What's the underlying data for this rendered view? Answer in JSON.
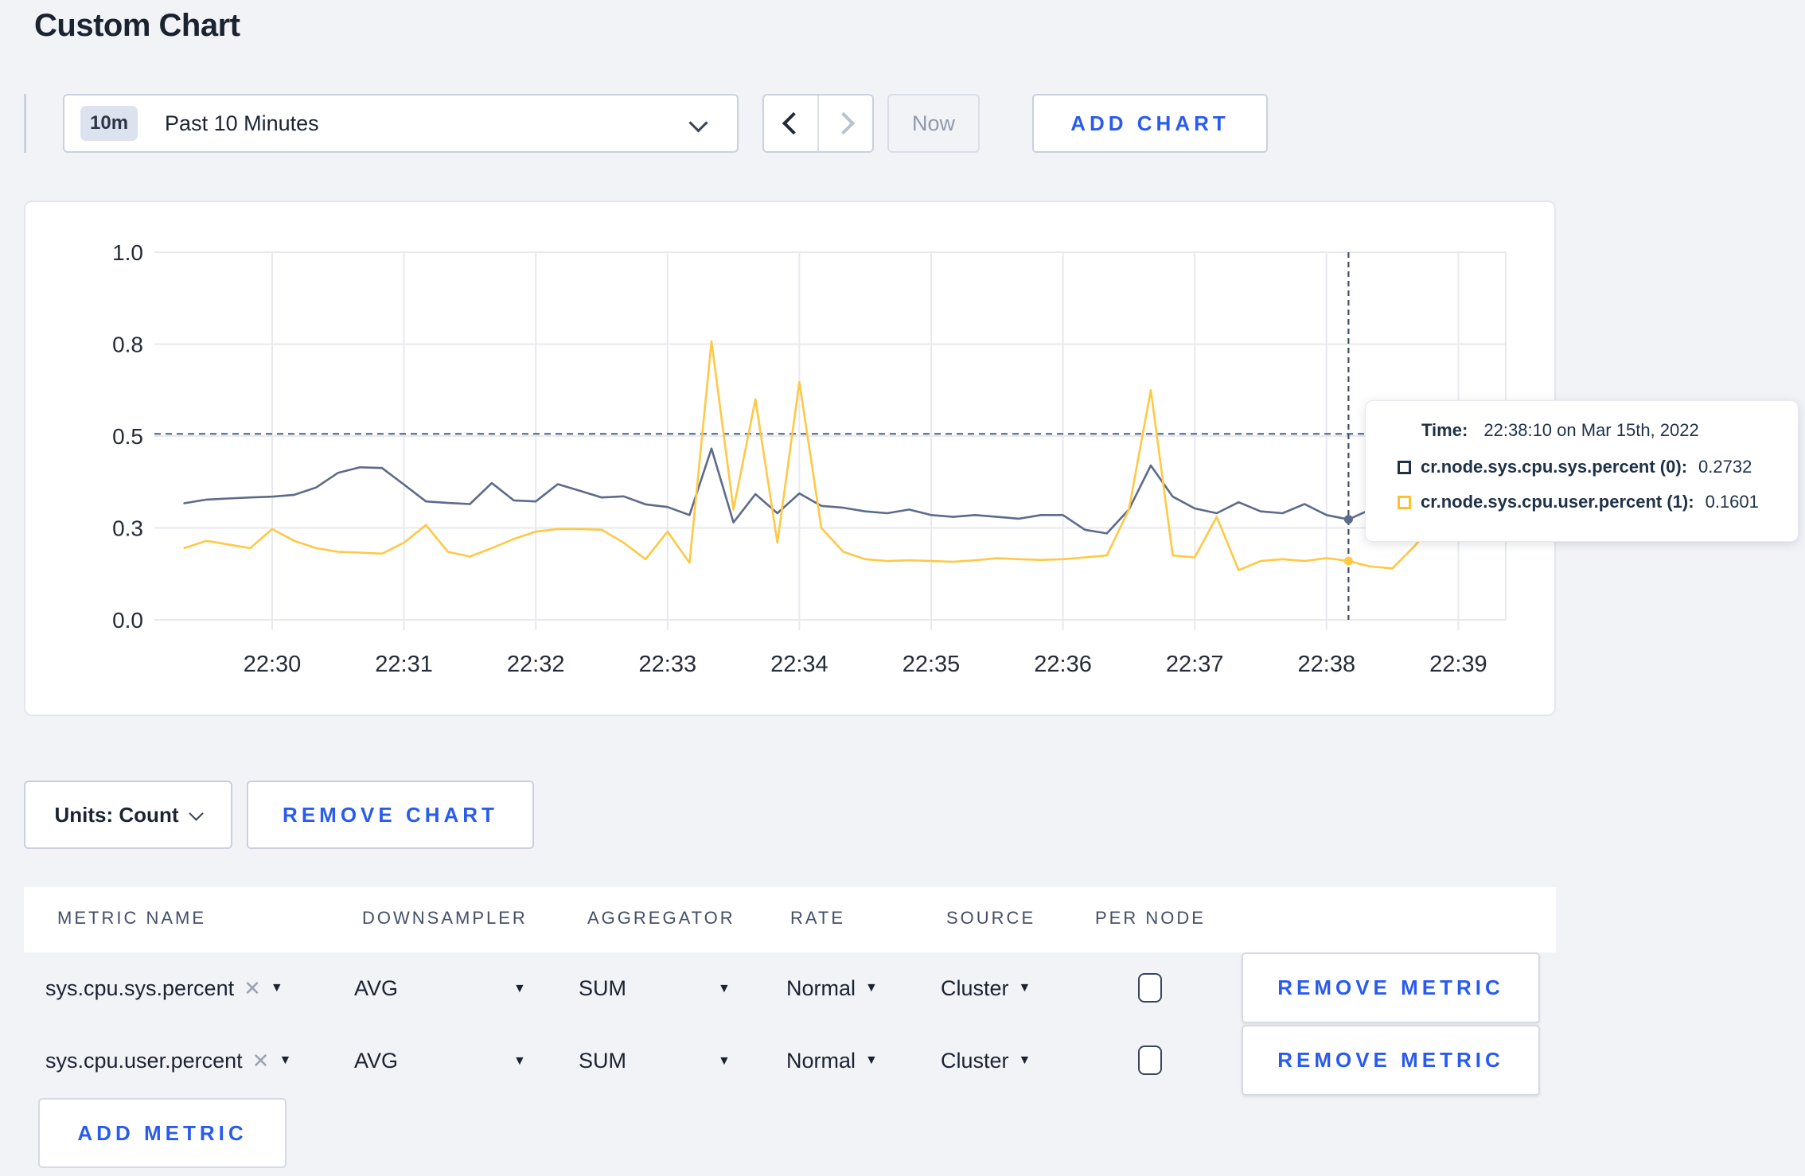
{
  "page": {
    "title": "Custom Chart"
  },
  "toolbar": {
    "time_selector": {
      "badge": "10m",
      "label": "Past 10 Minutes"
    },
    "now_button": "Now",
    "add_chart_button": "ADD CHART"
  },
  "chart_data": {
    "type": "line",
    "title": "",
    "xlabel": "",
    "ylabel": "",
    "start_time": "22:29:20",
    "interval_seconds": 10,
    "ylim": [
      0,
      1
    ],
    "grid": true,
    "legend_position": "tooltip-only",
    "y_ticks": [
      {
        "value": 0.0,
        "label": "0.0"
      },
      {
        "value": 0.25,
        "label": "0.3"
      },
      {
        "value": 0.5,
        "label": "0.5"
      },
      {
        "value": 0.75,
        "label": "0.8"
      },
      {
        "value": 1.0,
        "label": "1.0"
      }
    ],
    "x_ticks": [
      "22:30",
      "22:31",
      "22:32",
      "22:33",
      "22:34",
      "22:35",
      "22:36",
      "22:37",
      "22:38",
      "22:39"
    ],
    "series": [
      {
        "name": "cr.node.sys.cpu.sys.percent (0)",
        "color": "#5b6b89",
        "values": [
          0.317,
          0.327,
          0.33,
          0.333,
          0.335,
          0.34,
          0.36,
          0.4,
          0.415,
          0.413,
          0.368,
          0.322,
          0.318,
          0.315,
          0.372,
          0.325,
          0.322,
          0.369,
          0.351,
          0.333,
          0.336,
          0.314,
          0.307,
          0.285,
          0.466,
          0.265,
          0.342,
          0.29,
          0.344,
          0.31,
          0.305,
          0.295,
          0.29,
          0.3,
          0.285,
          0.28,
          0.285,
          0.28,
          0.275,
          0.285,
          0.285,
          0.245,
          0.235,
          0.3,
          0.42,
          0.335,
          0.303,
          0.29,
          0.32,
          0.295,
          0.29,
          0.315,
          0.285,
          0.2732,
          0.3,
          0.31,
          0.315,
          0.3,
          0.295,
          0.305,
          0.295
        ]
      },
      {
        "name": "cr.node.sys.cpu.user.percent (1)",
        "color": "#ffc845",
        "values": [
          0.195,
          0.215,
          0.205,
          0.195,
          0.247,
          0.215,
          0.195,
          0.185,
          0.183,
          0.18,
          0.21,
          0.258,
          0.185,
          0.172,
          0.195,
          0.22,
          0.24,
          0.247,
          0.247,
          0.245,
          0.21,
          0.165,
          0.24,
          0.155,
          0.758,
          0.3,
          0.6,
          0.21,
          0.647,
          0.25,
          0.185,
          0.165,
          0.16,
          0.162,
          0.16,
          0.158,
          0.162,
          0.168,
          0.165,
          0.163,
          0.165,
          0.17,
          0.175,
          0.3,
          0.625,
          0.175,
          0.17,
          0.28,
          0.135,
          0.16,
          0.165,
          0.16,
          0.168,
          0.1601,
          0.145,
          0.14,
          0.2,
          0.27,
          0.28,
          0.215,
          0.285
        ]
      }
    ],
    "threshold_line": {
      "value": 0.506,
      "style": "dashed",
      "color": "#527099"
    },
    "cursor": {
      "index": 53,
      "time": "22:38:10",
      "color": "#3f4e68"
    }
  },
  "tooltip": {
    "time_label": "Time:",
    "time_value": "22:38:10 on Mar 15th, 2022",
    "rows": [
      {
        "label": "cr.node.sys.cpu.sys.percent (0):",
        "value": "0.2732",
        "swatch_color": "#1e3148"
      },
      {
        "label": "cr.node.sys.cpu.user.percent (1):",
        "value": "0.1601",
        "swatch_color": "#fdc12c"
      }
    ]
  },
  "units_bar": {
    "units_label": "Units: Count",
    "remove_chart_button": "REMOVE CHART"
  },
  "metrics_table": {
    "headers": [
      "METRIC NAME",
      "DOWNSAMPLER",
      "AGGREGATOR",
      "RATE",
      "SOURCE",
      "PER NODE"
    ],
    "rows": [
      {
        "name": "sys.cpu.sys.percent",
        "downsampler": "AVG",
        "aggregator": "SUM",
        "rate": "Normal",
        "source": "Cluster",
        "per_node_checked": false,
        "remove_button": "REMOVE METRIC"
      },
      {
        "name": "sys.cpu.user.percent",
        "downsampler": "AVG",
        "aggregator": "SUM",
        "rate": "Normal",
        "source": "Cluster",
        "per_node_checked": false,
        "remove_button": "REMOVE METRIC"
      }
    ],
    "add_metric_button": "ADD METRIC"
  },
  "icons": {
    "close": "✕",
    "caret_down": "▼"
  }
}
